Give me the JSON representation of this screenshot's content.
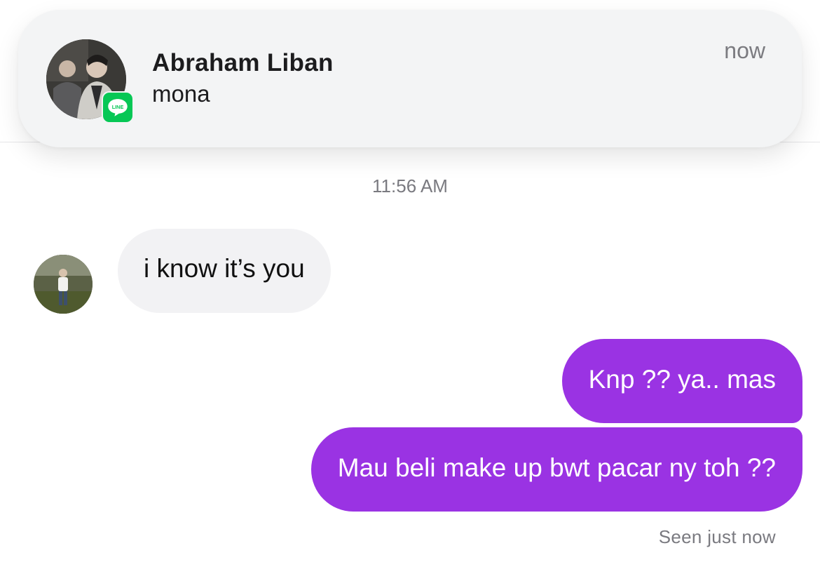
{
  "notification": {
    "sender": "Abraham Liban",
    "message": "mona",
    "time": "now",
    "app_icon": "line-app-icon",
    "app_icon_label": "LINE",
    "app_color": "#06c755"
  },
  "chat": {
    "timestamp": "11:56 AM",
    "messages": [
      {
        "direction": "incoming",
        "text": "i know it’s you"
      },
      {
        "direction": "outgoing",
        "text": "Knp ?? ya.. mas"
      },
      {
        "direction": "outgoing",
        "text": "Mau beli make up bwt pacar ny toh ??"
      }
    ],
    "seen_status": "Seen just now",
    "outgoing_color": "#9a33e3",
    "incoming_color": "#f2f2f4"
  }
}
